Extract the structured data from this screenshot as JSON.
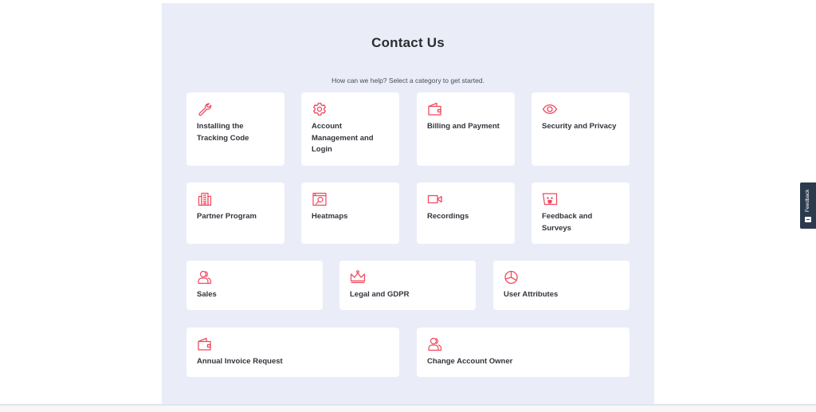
{
  "header": {
    "title": "Contact Us",
    "subtitle": "How can we help? Select a category to get started."
  },
  "theme": {
    "accent": "#f0485e",
    "panel_background": "#eaecf8",
    "card_background": "#ffffff",
    "text": "#33353c",
    "feedback_tab": "#2c3a4e"
  },
  "categories": [
    {
      "label": "Installing the Tracking Code",
      "icon": "wrench-icon"
    },
    {
      "label": "Account Management and Login",
      "icon": "gear-icon"
    },
    {
      "label": "Billing and Payment",
      "icon": "wallet-icon"
    },
    {
      "label": "Security and Privacy",
      "icon": "eye-icon"
    },
    {
      "label": "Partner Program",
      "icon": "building-icon"
    },
    {
      "label": "Heatmaps",
      "icon": "heatmap-search-icon"
    },
    {
      "label": "Recordings",
      "icon": "video-camera-icon"
    },
    {
      "label": "Feedback and Surveys",
      "icon": "feedback-face-icon"
    },
    {
      "label": "Sales",
      "icon": "users-icon"
    },
    {
      "label": "Legal and GDPR",
      "icon": "crown-icon"
    },
    {
      "label": "User Attributes",
      "icon": "pie-chart-icon"
    },
    {
      "label": "Annual Invoice Request",
      "icon": "wallet-icon"
    },
    {
      "label": "Change Account Owner",
      "icon": "users-icon"
    }
  ],
  "feedback_tab": {
    "label": "Feedback",
    "icon": "feedback-envelope-icon"
  }
}
